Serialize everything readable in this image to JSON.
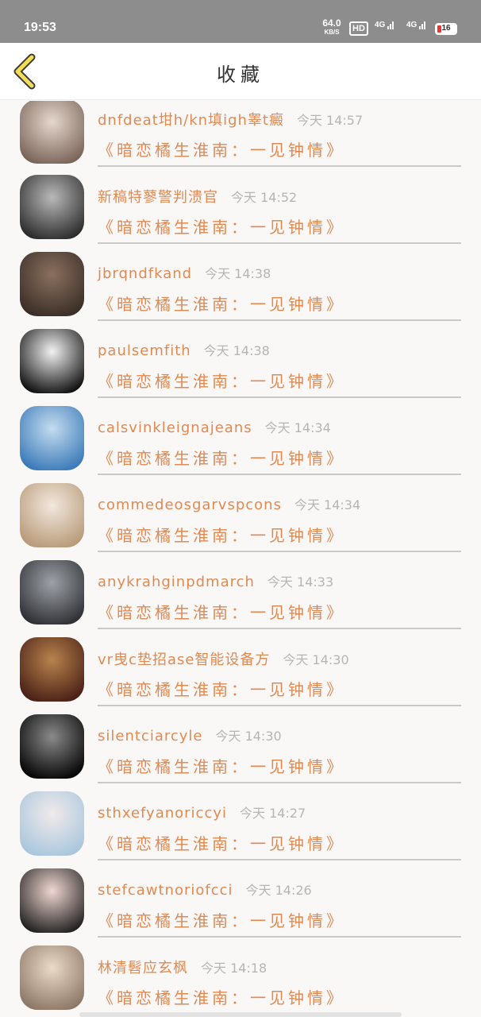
{
  "status": {
    "time": "19:53",
    "speed": "64.0",
    "speed_unit": "KB/S",
    "hd": "HD",
    "sig1": "4G",
    "sig2": "4G",
    "battery": "16"
  },
  "header": {
    "title": "收藏"
  },
  "items": [
    {
      "user": "dnfdeat坩h/kn填igh睾t癜",
      "time": "今天 14:57",
      "book": "《暗恋橘生淮南：一见钟情》",
      "avatar": [
        "#7a6458",
        "#e6d8cd"
      ]
    },
    {
      "user": "新稿特蓼警判溃官",
      "time": "今天 14:52",
      "book": "《暗恋橘生淮南：一见钟情》",
      "avatar": [
        "#2c2c2c",
        "#b9b9b9"
      ]
    },
    {
      "user": "jbrqndfkand",
      "time": "今天 14:38",
      "book": "《暗恋橘生淮南：一见钟情》",
      "avatar": [
        "#3a2e26",
        "#8a7060"
      ]
    },
    {
      "user": "paulsemfith",
      "time": "今天 14:38",
      "book": "《暗恋橘生淮南：一见钟情》",
      "avatar": [
        "#111111",
        "#f2f2f2"
      ]
    },
    {
      "user": "calsvinkleignajeans",
      "time": "今天 14:34",
      "book": "《暗恋橘生淮南：一见钟情》",
      "avatar": [
        "#3a7ab8",
        "#c5dcef"
      ]
    },
    {
      "user": "commedeosgarvspcons",
      "time": "今天 14:34",
      "book": "《暗恋橘生淮南：一见钟情》",
      "avatar": [
        "#b89a78",
        "#f1e8df"
      ]
    },
    {
      "user": "anykrahginpdmarch",
      "time": "今天 14:33",
      "book": "《暗恋橘生淮南：一见钟情》",
      "avatar": [
        "#2e3034",
        "#9ea2a8"
      ]
    },
    {
      "user": "vr曳c垫招ase智能设备方",
      "time": "今天 14:30",
      "book": "《暗恋橘生淮南：一见钟情》",
      "avatar": [
        "#4a2016",
        "#b7834e"
      ]
    },
    {
      "user": "silentciarcyle",
      "time": "今天 14:30",
      "book": "《暗恋橘生淮南：一见钟情》",
      "avatar": [
        "#050505",
        "#8a8a8a"
      ]
    },
    {
      "user": "sthxefyanoriccyi",
      "time": "今天 14:27",
      "book": "《暗恋橘生淮南：一见钟情》",
      "avatar": [
        "#a9c6dd",
        "#f1eaea"
      ]
    },
    {
      "user": "stefcawtnoriofcci",
      "time": "今天 14:26",
      "book": "《暗恋橘生淮南：一见钟情》",
      "avatar": [
        "#222222",
        "#f0d7d2"
      ]
    },
    {
      "user": "林清髫应玄枫",
      "time": "今天 14:18",
      "book": "《暗恋橘生淮南：一见钟情》",
      "avatar": [
        "#8d7766",
        "#eadbc8"
      ]
    }
  ]
}
